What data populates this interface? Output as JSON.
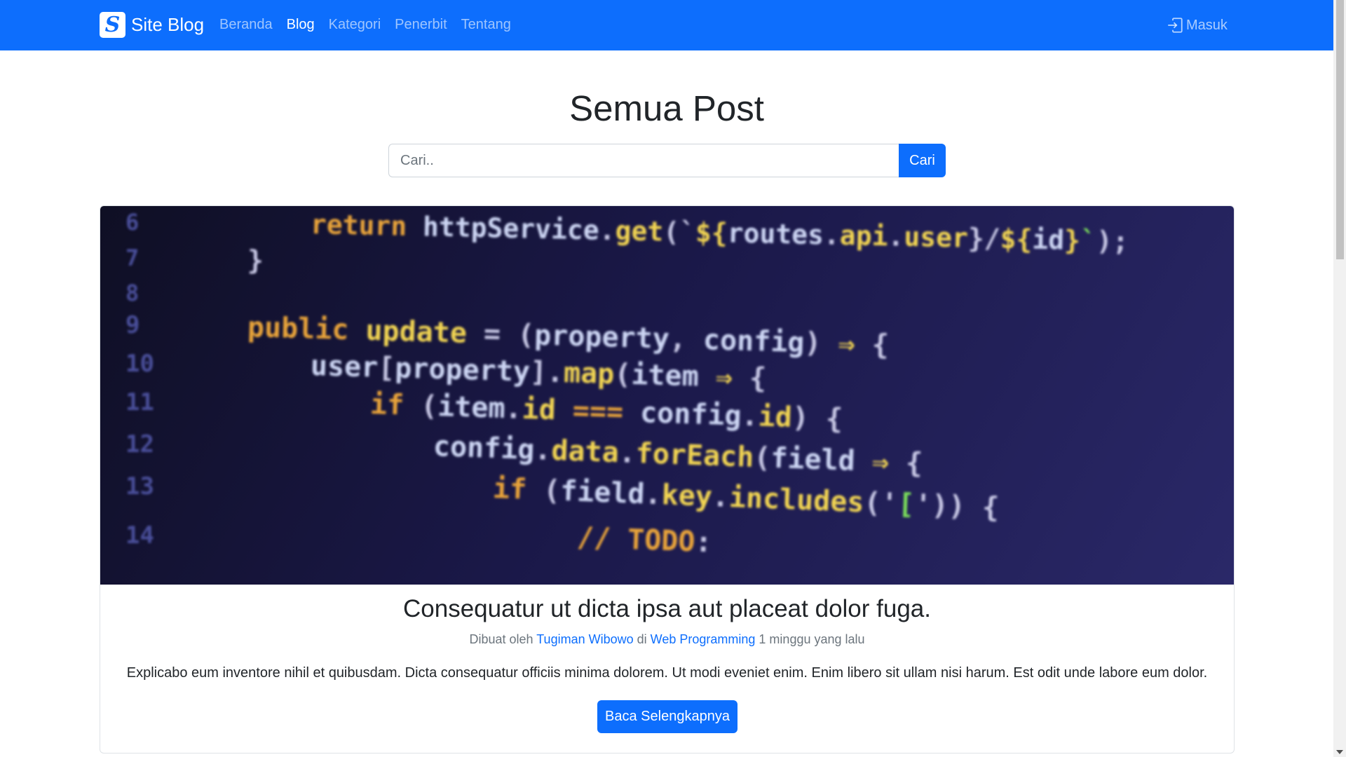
{
  "navbar": {
    "brand_logo": "S",
    "brand_name": "Site Blog",
    "links": [
      {
        "label": "Beranda",
        "active": false
      },
      {
        "label": "Blog",
        "active": true
      },
      {
        "label": "Kategori",
        "active": false
      },
      {
        "label": "Penerbit",
        "active": false
      },
      {
        "label": "Tentang",
        "active": false
      }
    ],
    "login_icon": "login-icon",
    "login_label": "Masuk",
    "color": "#0d6efd"
  },
  "header": {
    "title": "Semua Post",
    "search_placeholder": "Cari..",
    "search_value": "",
    "search_button": "Cari"
  },
  "post": {
    "image_code": [
      {
        "num": "6",
        "tokens": [
          [
            "kw",
            "return "
          ],
          [
            "id",
            "httpService"
          ],
          [
            "pl",
            "."
          ],
          [
            "fn",
            "get"
          ],
          [
            "pl",
            "(`"
          ],
          [
            "fn",
            "${"
          ],
          [
            "id",
            "routes"
          ],
          [
            "pl",
            "."
          ],
          [
            "fn",
            "api"
          ],
          [
            "pl",
            "."
          ],
          [
            "fn",
            "user"
          ],
          [
            "pl",
            "}/"
          ],
          [
            "fn",
            "${"
          ],
          [
            "id",
            "id"
          ],
          [
            "fn",
            "}"
          ],
          [
            "gr",
            "`"
          ],
          [
            "pl",
            ");"
          ]
        ]
      },
      {
        "num": "7",
        "tokens": [
          [
            "pl",
            "}"
          ]
        ]
      },
      {
        "num": "8",
        "tokens": []
      },
      {
        "num": "9",
        "tokens": [
          [
            "kw",
            "public "
          ],
          [
            "fn",
            "update "
          ],
          [
            "pl",
            "= ("
          ],
          [
            "id",
            "property"
          ],
          [
            "pl",
            ", "
          ],
          [
            "id",
            "config"
          ],
          [
            "pl",
            ") "
          ],
          [
            "fn",
            "⇒ "
          ],
          [
            "pl",
            "{"
          ]
        ]
      },
      {
        "num": "10",
        "tokens": [
          [
            "id",
            "user"
          ],
          [
            "pl",
            "["
          ],
          [
            "id",
            "property"
          ],
          [
            "pl",
            "]."
          ],
          [
            "fn",
            "map"
          ],
          [
            "pl",
            "("
          ],
          [
            "id",
            "item "
          ],
          [
            "fn",
            "⇒ "
          ],
          [
            "pl",
            "{"
          ]
        ]
      },
      {
        "num": "11",
        "tokens": [
          [
            "kw",
            "if "
          ],
          [
            "pl",
            "("
          ],
          [
            "id",
            "item"
          ],
          [
            "pl",
            "."
          ],
          [
            "fn",
            "id "
          ],
          [
            "kw",
            "=== "
          ],
          [
            "id",
            "config"
          ],
          [
            "pl",
            "."
          ],
          [
            "fn",
            "id"
          ],
          [
            "pl",
            ") {"
          ]
        ]
      },
      {
        "num": "12",
        "tokens": [
          [
            "id",
            "config"
          ],
          [
            "pl",
            "."
          ],
          [
            "fn",
            "data"
          ],
          [
            "pl",
            "."
          ],
          [
            "fn",
            "forEach"
          ],
          [
            "pl",
            "("
          ],
          [
            "id",
            "field "
          ],
          [
            "fn",
            "⇒ "
          ],
          [
            "pl",
            "{"
          ]
        ]
      },
      {
        "num": "13",
        "tokens": [
          [
            "kw",
            "if "
          ],
          [
            "pl",
            "("
          ],
          [
            "id",
            "field"
          ],
          [
            "pl",
            "."
          ],
          [
            "fn",
            "key"
          ],
          [
            "pl",
            "."
          ],
          [
            "fn",
            "includes"
          ],
          [
            "pl",
            "('"
          ],
          [
            "gr",
            "["
          ],
          [
            "pl",
            "')) {"
          ]
        ]
      },
      {
        "num": "14",
        "tokens": [
          [
            "kw",
            "// "
          ],
          [
            "kw",
            "TODO"
          ],
          [
            "pl",
            ":"
          ]
        ]
      }
    ],
    "title": "Consequatur ut dicta ipsa aut placeat dolor fuga.",
    "meta_prefix": "Dibuat oleh",
    "author": "Tugiman Wibowo",
    "meta_in": "di",
    "category": "Web Programming",
    "time": "1 minggu yang lalu",
    "excerpt": "Explicabo eum inventore nihil et quibusdam. Dicta consequatur officiis minima dolorem. Ut modi eveniet enim. Enim libero sit ullam nisi harum. Est odit unde labore eum dolor.",
    "read_more": "Baca Selengkapnya"
  }
}
